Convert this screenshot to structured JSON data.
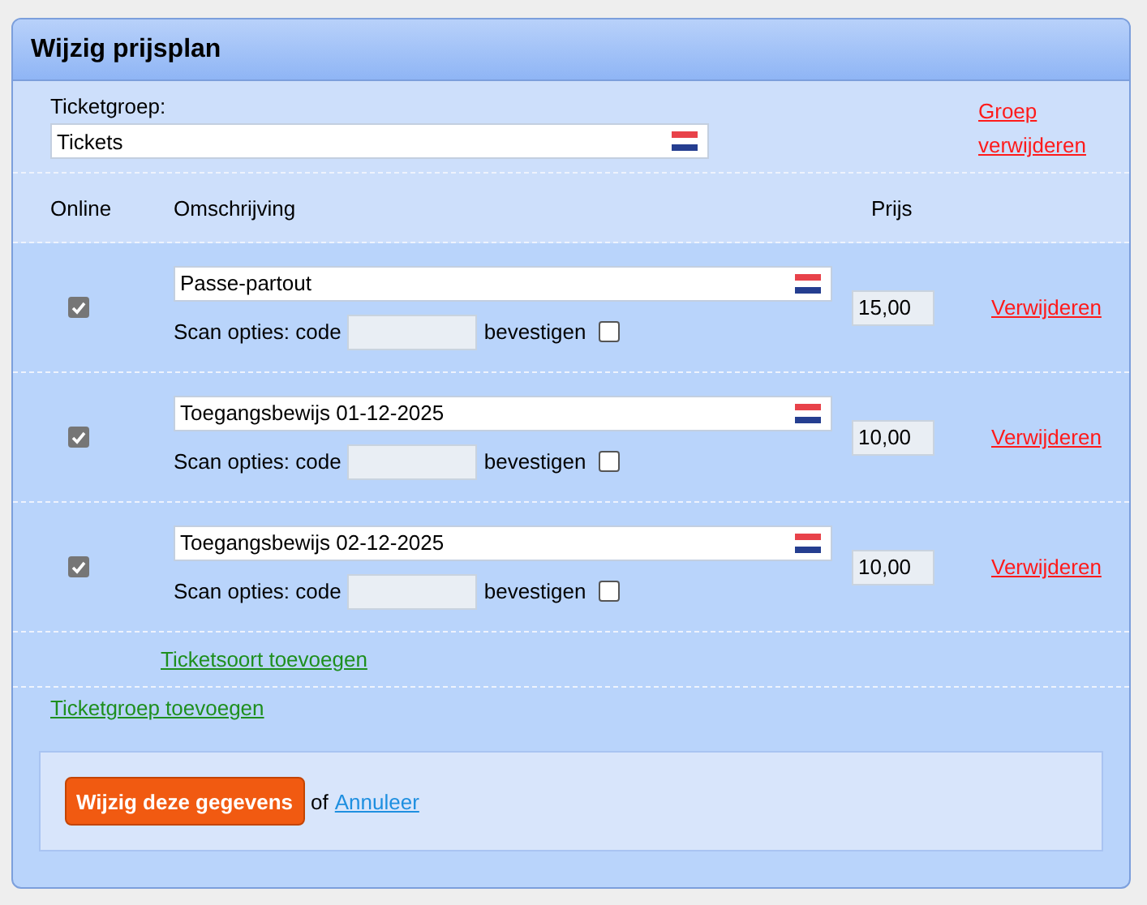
{
  "panel": {
    "title": "Wijzig prijsplan"
  },
  "group": {
    "label": "Ticketgroep:",
    "value": "Tickets",
    "remove_link": "Groep verwijderen"
  },
  "columns": [
    "Online",
    "Omschrijving",
    "Prijs"
  ],
  "tickets": [
    {
      "online": true,
      "description": "Passe-partout",
      "price": "15,00",
      "scan_label": "Scan opties: code",
      "confirm_label": "bevestigen",
      "confirm": false,
      "remove_link": "Verwijderen"
    },
    {
      "online": true,
      "description": "Toegangsbewijs 01-12-2025",
      "price": "10,00",
      "scan_label": "Scan opties: code",
      "confirm_label": "bevestigen",
      "confirm": false,
      "remove_link": "Verwijderen"
    },
    {
      "online": true,
      "description": "Toegangsbewijs 02-12-2025",
      "price": "10,00",
      "scan_label": "Scan opties: code",
      "confirm_label": "bevestigen",
      "confirm": false,
      "remove_link": "Verwijderen"
    }
  ],
  "add_ticket_type": "Ticketsoort toevoegen",
  "add_ticket_group": "Ticketgroep toevoegen",
  "footer": {
    "submit": "Wijzig deze gegevens",
    "or": "of",
    "cancel": "Annuleer"
  }
}
